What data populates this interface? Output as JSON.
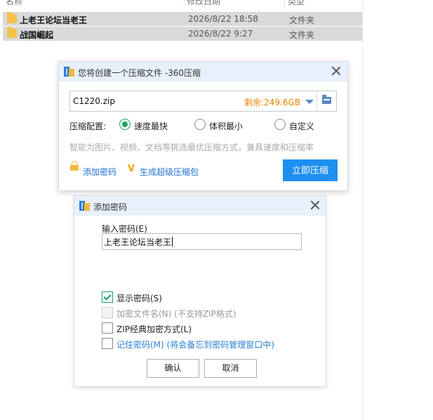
{
  "explorer": {
    "columns": {
      "name": "名称",
      "date": "修改日期",
      "type": "类型"
    },
    "files": [
      {
        "name": "上老王论坛当老王",
        "date": "2026/8/22 18:58",
        "type": "文件夹"
      },
      {
        "name": "战国崛起",
        "date": "2026/8/22 9:27",
        "type": "文件夹"
      }
    ]
  },
  "compress_dialog": {
    "title": "您将创建一个压缩文件 -360压缩",
    "filename": "C1220.zip",
    "space_left": "剩余:249.6GB",
    "config_label": "压缩配置:",
    "options": [
      {
        "label": "速度最快",
        "selected": true
      },
      {
        "label": "体积最小",
        "selected": false
      },
      {
        "label": "自定义",
        "selected": false
      }
    ],
    "hint": "智能为图片、视频、文档等挑选最优压缩方式，兼具速度和压缩率",
    "add_password_link": "添加密码",
    "super_pack_link": "生成超级压缩包",
    "compress_button": "立即压缩"
  },
  "password_dialog": {
    "title": "添加密码",
    "input_label": "输入密码(E)",
    "password_value": "上老王论坛当老王",
    "checkboxes": [
      {
        "label": "显示密码(S)",
        "checked": true,
        "enabled": true
      },
      {
        "label": "加密文件名(N) (不支持ZIP格式)",
        "checked": false,
        "enabled": false
      },
      {
        "label": "ZIP经典加密方式(L)",
        "checked": false,
        "enabled": true
      },
      {
        "label": "记住密码(M) (将会备忘到密码管理窗口中)",
        "checked": false,
        "enabled": true
      }
    ],
    "ok_button": "确认",
    "cancel_button": "取消"
  },
  "colors": {
    "accent": "#1e8ff0",
    "radio_selected": "#1aa260",
    "space_text": "#f08300",
    "link": "#1f6fd1",
    "title_bar": "#e7f0fb",
    "row_selected": "#d9d9d9"
  }
}
